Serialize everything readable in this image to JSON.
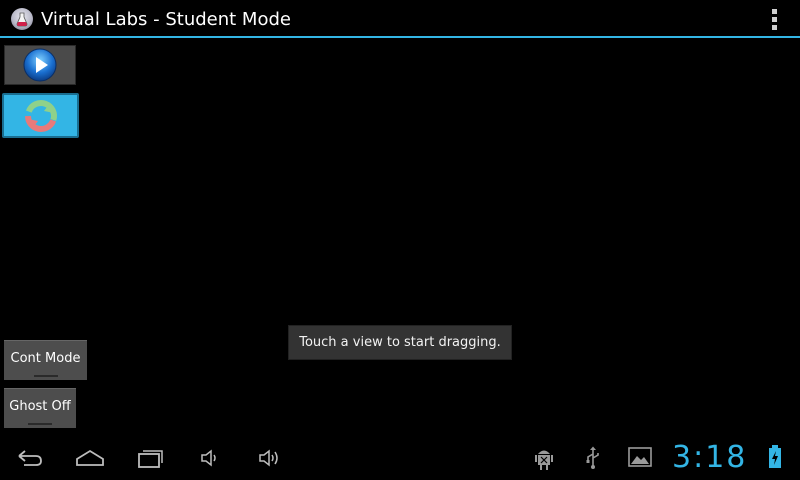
{
  "action_bar": {
    "title": "Virtual Labs - Student Mode",
    "app_icon": "flask-icon",
    "menu_icon": "overflow-menu-icon",
    "accent_color": "#33b5e5"
  },
  "toolbar": {
    "play_icon": "play-icon",
    "refresh_icon": "refresh-icon"
  },
  "buttons": {
    "cont_mode_label": "Cont Mode",
    "ghost_off_label": "Ghost Off"
  },
  "toast": {
    "message": "Touch a view to start dragging."
  },
  "system_bar": {
    "clock": "3:18",
    "icons": [
      "back-icon",
      "home-icon",
      "recent-apps-icon",
      "volume-down-icon",
      "volume-up-icon",
      "android-debug-icon",
      "usb-icon",
      "image-icon",
      "battery-charging-icon"
    ]
  }
}
